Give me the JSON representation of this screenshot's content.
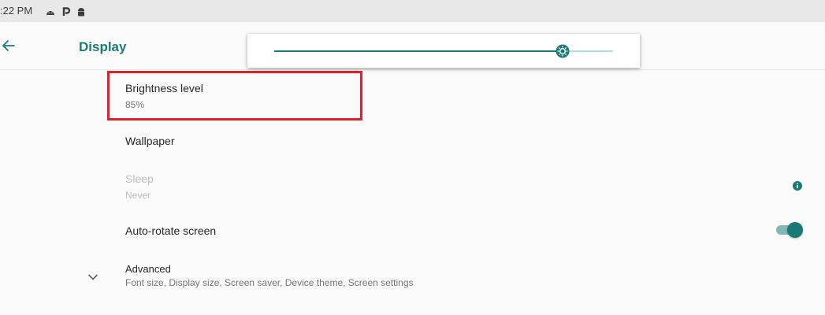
{
  "status_bar": {
    "time": ":22 PM",
    "icons": [
      "android-head-icon",
      "parking-p-icon",
      "android-robot-icon"
    ]
  },
  "app_bar": {
    "back_icon": "arrow-left-icon",
    "title": "Display"
  },
  "brightness_slider": {
    "value_percent": 85
  },
  "settings": {
    "brightness": {
      "title": "Brightness level",
      "summary": "85%"
    },
    "wallpaper": {
      "title": "Wallpaper"
    },
    "sleep": {
      "title": "Sleep",
      "summary": "Never",
      "disabled": true,
      "trailing_icon": "info-icon"
    },
    "auto_rotate": {
      "title": "Auto-rotate screen",
      "checked": true
    },
    "advanced": {
      "title": "Advanced",
      "summary": "Font size, Display size, Screen saver, Device theme, Screen settings",
      "icon": "chevron-down-icon"
    }
  },
  "colors": {
    "accent": "#187a75",
    "accent_light": "#b2dfdb",
    "highlight": "#e0202b"
  }
}
